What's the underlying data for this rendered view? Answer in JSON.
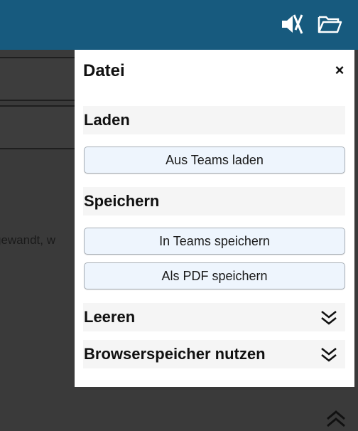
{
  "topbar": {
    "icons": [
      "mute-icon",
      "folder-open-icon"
    ],
    "color": "#175a7e"
  },
  "background": {
    "partial_text": "gewandt, w"
  },
  "panel": {
    "title": "Datei",
    "close_label": "×",
    "sections": {
      "laden": {
        "title": "Laden",
        "button": "Aus Teams laden"
      },
      "speichern": {
        "title": "Speichern",
        "buttons": [
          "In Teams speichern",
          "Als PDF speichern"
        ]
      },
      "leeren": {
        "title": "Leeren",
        "icon": "double-chevron-down-icon"
      },
      "browserspeicher": {
        "title": "Browserspeicher nutzen",
        "icon": "double-chevron-down-icon"
      }
    }
  },
  "colors": {
    "button_bg": "#eef5fd",
    "section_bg": "#f5f5f5"
  }
}
